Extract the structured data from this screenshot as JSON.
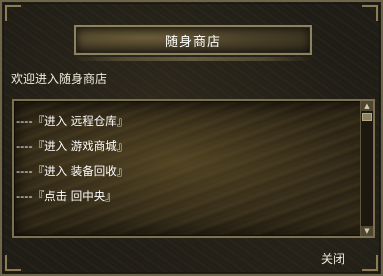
{
  "window": {
    "title": "随身商店",
    "welcome_text": "欢迎进入随身商店"
  },
  "menu": {
    "items": [
      {
        "label": "----『进入 远程仓库』"
      },
      {
        "label": "----『进入 游戏商城』"
      },
      {
        "label": "----『进入 装备回收』"
      },
      {
        "label": "----『点击 回中央』"
      }
    ]
  },
  "footer": {
    "close_label": "关闭"
  },
  "icons": {
    "scroll_up": "scroll-up-arrow-icon",
    "scroll_down": "scroll-down-arrow-icon"
  },
  "colors": {
    "text": "#ffffff",
    "frame": "#7b7150"
  }
}
